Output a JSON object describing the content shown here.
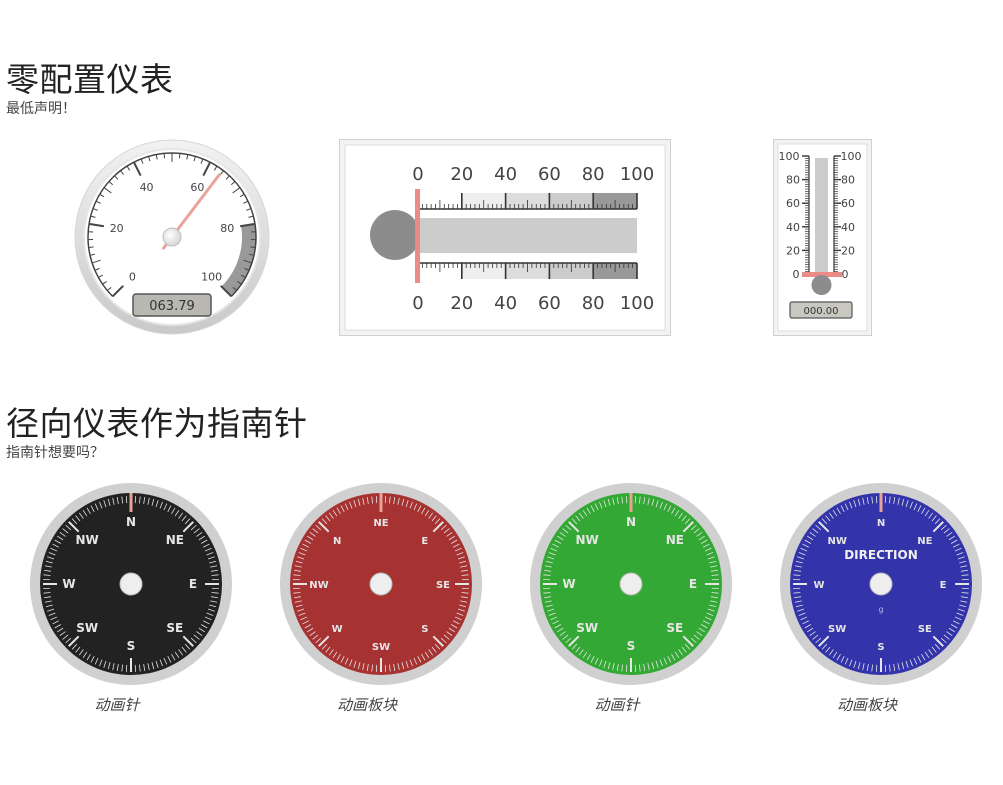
{
  "section1": {
    "title": "零配置仪表",
    "subtitle": "最低声明！"
  },
  "radial_gauge": {
    "ticks": [
      "0",
      "20",
      "40",
      "60",
      "80",
      "100"
    ],
    "value_display": "063.79",
    "value": 63.79,
    "min": 0,
    "max": 100,
    "highlight_from": 80,
    "highlight_to": 100,
    "needle_color": "#e8a398"
  },
  "linear_gauge": {
    "ticks": [
      "0",
      "20",
      "40",
      "60",
      "80",
      "100"
    ],
    "value": 0,
    "min": 0,
    "max": 100,
    "bulb_color": "#8c8c8c",
    "needle_color": "#ec8a86"
  },
  "thermometer": {
    "ticks": [
      "100",
      "80",
      "60",
      "40",
      "20",
      "0"
    ],
    "value_display": "000.00",
    "value": 0
  },
  "section2": {
    "title": "径向仪表作为指南针",
    "subtitle": "指南针想要吗？"
  },
  "compasses": [
    {
      "face_color": "#222222",
      "labels": [
        "N",
        "NE",
        "E",
        "SE",
        "S",
        "SW",
        "W",
        "NW"
      ],
      "title": "",
      "unit": "",
      "caption": "动画针"
    },
    {
      "face_color": "#a63232",
      "labels": [
        "NE",
        "E",
        "SE",
        "S",
        "SW",
        "W",
        "NW",
        "N"
      ],
      "title": "",
      "unit": "",
      "caption": "动画板块"
    },
    {
      "face_color": "#34a834",
      "labels": [
        "N",
        "NE",
        "E",
        "SE",
        "S",
        "SW",
        "W",
        "NW"
      ],
      "title": "",
      "unit": "",
      "caption": "动画针"
    },
    {
      "face_color": "#3333aa",
      "labels": [
        "N",
        "NE",
        "E",
        "SE",
        "S",
        "SW",
        "W",
        "NW"
      ],
      "title": "DIRECTION",
      "unit": "g",
      "caption": "动画板块"
    }
  ]
}
